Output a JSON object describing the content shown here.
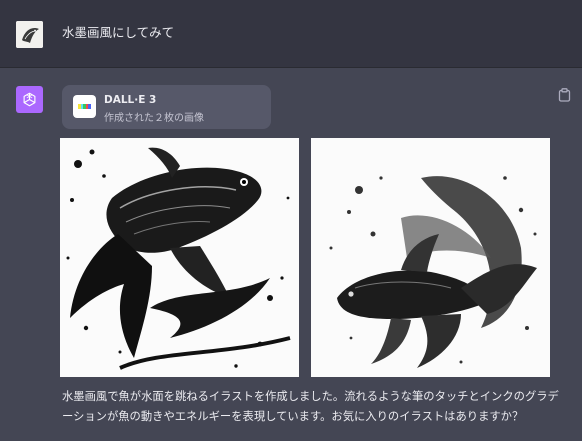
{
  "conversation": {
    "user_message": "水墨画風にしてみて",
    "assistant": {
      "tool_card": {
        "name": "DALL·E 3",
        "subtitle": "作成された２枚の画像",
        "logo_colors": [
          "#f7e43b",
          "#5de0f5",
          "#35c861",
          "#f24a4a",
          "#4a63f2"
        ]
      },
      "images": [
        {
          "label": "koi fish ink wash illustration"
        },
        {
          "label": "betta fish ink wash illustration"
        }
      ],
      "reply_text": "水墨画風で魚が水面を跳ねるイラストを作成しました。流れるような筆のタッチとインクのグラデーションが魚の動きやエネルギーを表現しています。お気に入りのイラストはありますか？"
    }
  },
  "colors": {
    "user_row_bg": "#343541",
    "assistant_bg": "#444654",
    "bot_avatar": "#ab68ff",
    "card_bg": "#565869"
  },
  "icons": {
    "bot_avatar": "openai-logo-icon",
    "copy": "clipboard-icon"
  }
}
